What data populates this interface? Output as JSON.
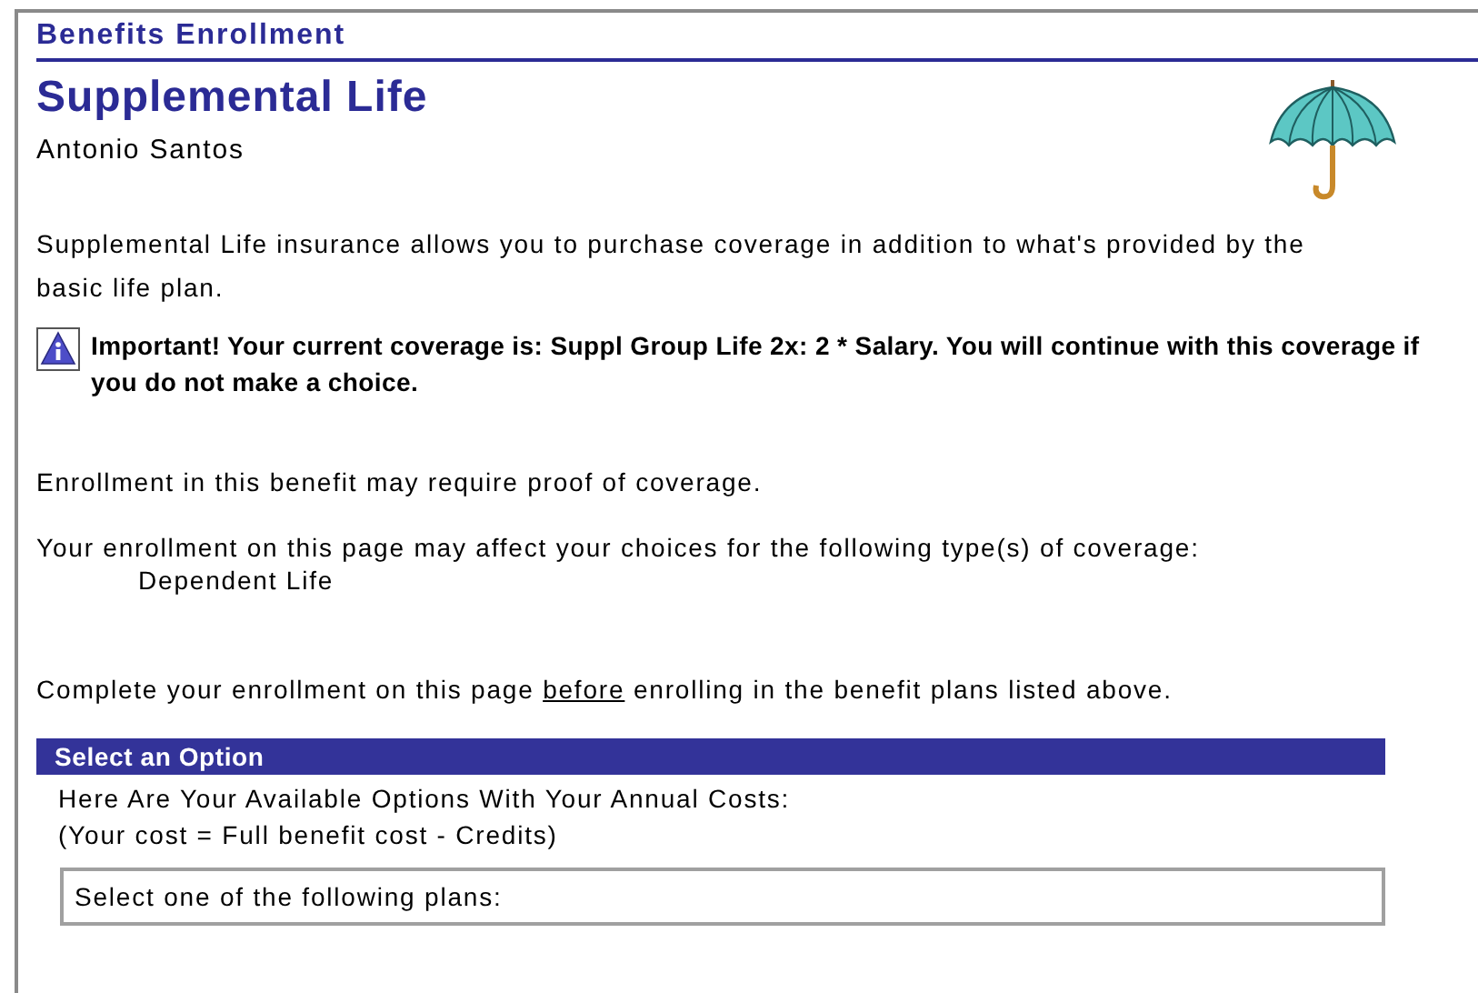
{
  "header": {
    "title": "Benefits Enrollment"
  },
  "page": {
    "title": "Supplemental Life",
    "employee": "Antonio Santos"
  },
  "intro": "Supplemental Life insurance allows you to purchase coverage in addition to what's provided by the basic life plan.",
  "notice": {
    "text": "Important! Your current coverage is: Suppl Group Life 2x: 2 * Salary. You will continue with this coverage if you do not make a choice."
  },
  "proof_note": "Enrollment in this benefit may require proof of coverage.",
  "affects": {
    "text": "Your enrollment on this page may affect your choices for the following type(s) of coverage:",
    "items": [
      "Dependent Life"
    ]
  },
  "complete_note": [
    {
      "text": "Complete your enrollment on this page ",
      "underline": false
    },
    {
      "text": "before",
      "underline": true
    },
    {
      "text": " enrolling in the benefit plans listed above.",
      "underline": false
    }
  ],
  "option_section": {
    "title": "Select an Option",
    "lines": [
      "Here Are Your Available Options With Your Annual Costs:",
      "(Your cost = Full benefit cost - Credits)"
    ],
    "plans_box": "Select one of the following plans:"
  }
}
